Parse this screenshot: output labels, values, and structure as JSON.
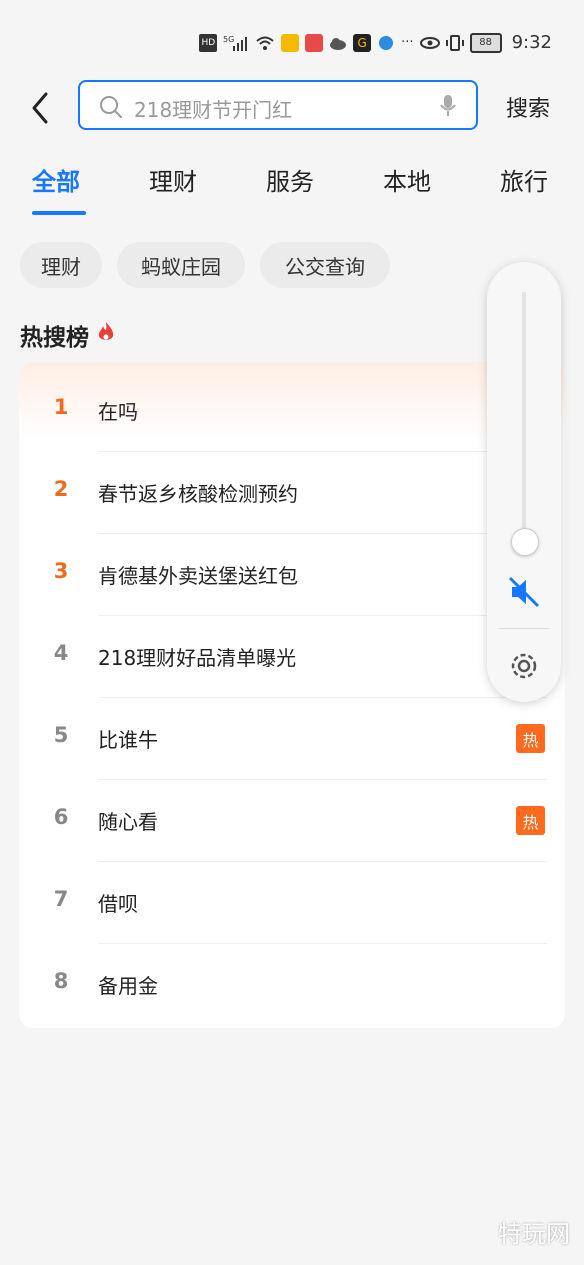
{
  "status_bar": {
    "hd": "HD",
    "signal": "5G",
    "battery": "88",
    "time": "9:32",
    "dots": "···"
  },
  "search": {
    "placeholder": "218理财节开门红",
    "button": "搜索"
  },
  "tabs": [
    "全部",
    "理财",
    "服务",
    "本地",
    "旅行"
  ],
  "chips": [
    "理财",
    "蚂蚁庄园",
    "公交查询"
  ],
  "hot_list": {
    "title": "热搜榜",
    "items": [
      {
        "rank": "1",
        "text": "在吗",
        "badge": ""
      },
      {
        "rank": "2",
        "text": "春节返乡核酸检测预约",
        "badge": ""
      },
      {
        "rank": "3",
        "text": "肯德基外卖送堡送红包",
        "badge": ""
      },
      {
        "rank": "4",
        "text": "218理财好品清单曝光",
        "badge": ""
      },
      {
        "rank": "5",
        "text": "比谁牛",
        "badge": "热"
      },
      {
        "rank": "6",
        "text": "随心看",
        "badge": "热"
      },
      {
        "rank": "7",
        "text": "借呗",
        "badge": ""
      },
      {
        "rank": "8",
        "text": "备用金",
        "badge": ""
      }
    ]
  },
  "volume_panel": {
    "level": 0.05,
    "muted": true
  },
  "watermark": "特玩网",
  "colors": {
    "accent": "#1677ff",
    "rank_top": "#f06a1e",
    "hot_badge": "#ff6a1e"
  }
}
